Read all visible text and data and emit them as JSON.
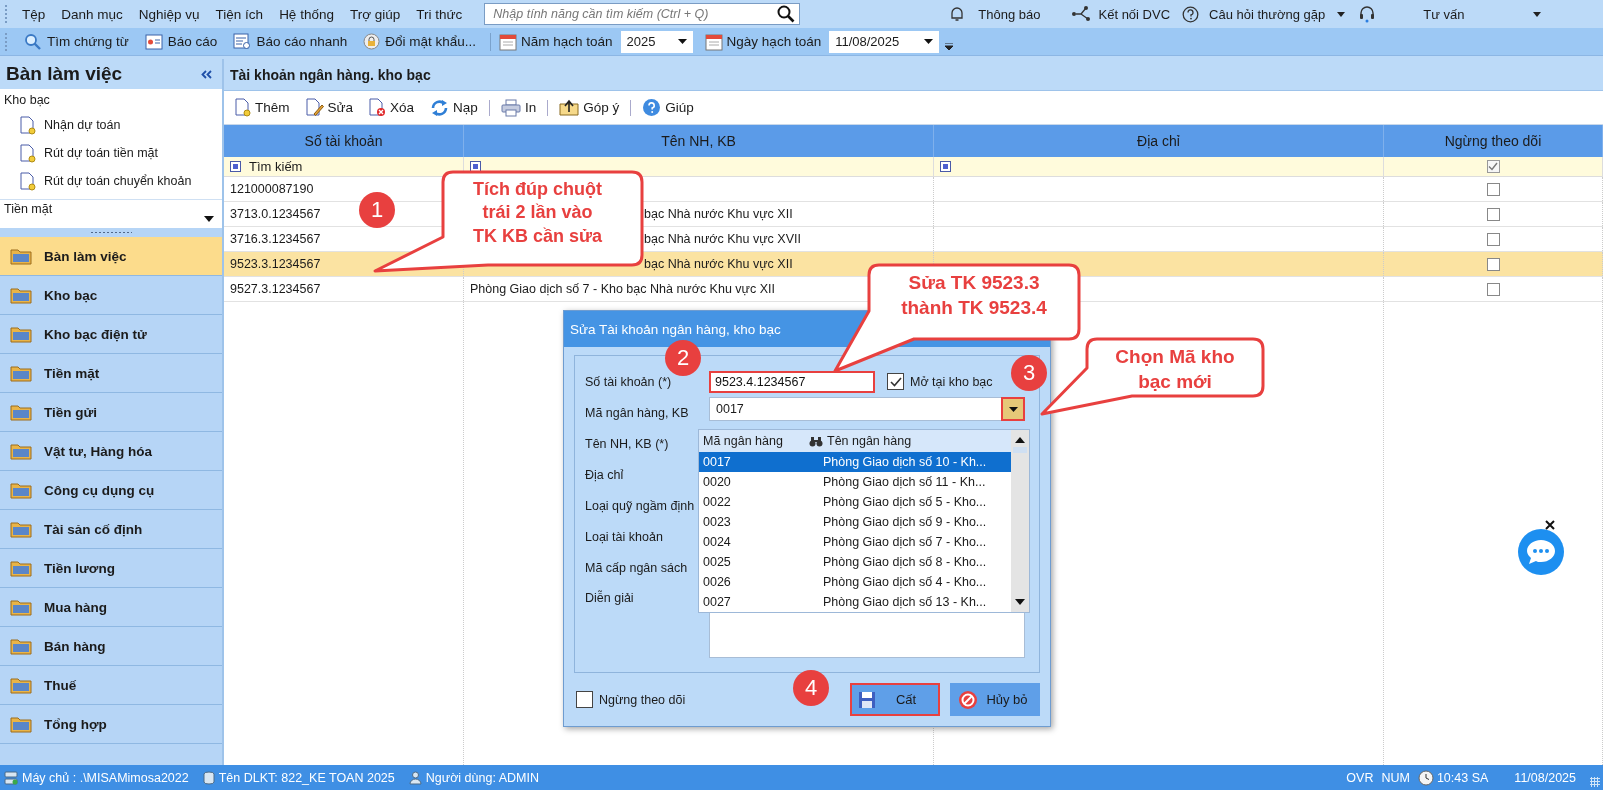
{
  "menu": [
    "Tệp",
    "Danh mục",
    "Nghiệp vụ",
    "Tiện ích",
    "Hệ thống",
    "Trợ giúp",
    "Tri thức"
  ],
  "search": {
    "placeholder": "Nhập tính năng cần tìm kiếm (Ctrl + Q)"
  },
  "top_links": [
    {
      "kind": "bell",
      "label": "Thông báo",
      "dropdown": false
    },
    {
      "kind": "network",
      "label": "Kết nối DVC",
      "dropdown": false
    },
    {
      "kind": "help",
      "label": "Câu hỏi thường gặp",
      "dropdown": true
    },
    {
      "kind": "headset",
      "label": "Tư vấn",
      "dropdown": true
    }
  ],
  "toolbar": [
    {
      "kind": "search",
      "label": "Tìm chứng từ"
    },
    {
      "kind": "report",
      "label": "Báo cáo"
    },
    {
      "kind": "quick_report",
      "label": "Báo cáo nhanh"
    },
    {
      "kind": "password",
      "label": "Đổi mật khẩu..."
    }
  ],
  "fiscal_year": {
    "label": "Năm hạch toán",
    "value": "2025"
  },
  "posting_date": {
    "label": "Ngày hạch toán",
    "value": "11/08/2025"
  },
  "sidebar": {
    "title": "Bàn làm việc",
    "tree": [
      {
        "label": "Kho bạc",
        "children": [
          {
            "label": "Nhận dự toán"
          },
          {
            "label": "Rút dự toán tiền mặt"
          },
          {
            "label": "Rút dự toán chuyển khoản"
          }
        ]
      }
    ],
    "group_select": "Tiền mặt",
    "items": [
      {
        "label": "Bàn làm việc",
        "selected": true
      },
      {
        "label": "Kho bạc",
        "selected": false
      },
      {
        "label": "Kho bạc điện tử",
        "selected": false
      },
      {
        "label": "Tiền mặt",
        "selected": false
      },
      {
        "label": "Tiền gửi",
        "selected": false
      },
      {
        "label": "Vật tư, Hàng hóa",
        "selected": false
      },
      {
        "label": "Công cụ dụng cụ",
        "selected": false
      },
      {
        "label": "Tài sản cố định",
        "selected": false
      },
      {
        "label": "Tiền lương",
        "selected": false
      },
      {
        "label": "Mua hàng",
        "selected": false
      },
      {
        "label": "Bán hàng",
        "selected": false
      },
      {
        "label": "Thuế",
        "selected": false
      },
      {
        "label": "Tổng hợp",
        "selected": false
      }
    ]
  },
  "page": {
    "title": "Tài khoản ngân hàng. kho bạc",
    "actions": [
      {
        "kind": "add",
        "label": "Thêm",
        "separator_after": false
      },
      {
        "kind": "edit",
        "label": "Sửa",
        "separator_after": false
      },
      {
        "kind": "delete",
        "label": "Xóa",
        "separator_after": false
      },
      {
        "kind": "reload",
        "label": "Nạp",
        "separator_after": true
      },
      {
        "kind": "print",
        "label": "In",
        "separator_after": true
      },
      {
        "kind": "feedback",
        "label": "Góp ý",
        "separator_after": true
      },
      {
        "kind": "help",
        "label": "Giúp",
        "separator_after": false
      }
    ]
  },
  "table": {
    "columns": [
      "Số tài khoản",
      "Tên NH, KB",
      "Địa chỉ",
      "Ngừng theo dõi"
    ],
    "filter_row": {
      "label": "Tìm kiếm",
      "checked": true
    },
    "rows": [
      {
        "account": "121000087190",
        "stopped": false,
        "selected": false
      },
      {
        "account": "3713.0.1234567",
        "name": "bạc Nhà nước Khu vực XII",
        "covered": true,
        "stopped": false,
        "selected": false
      },
      {
        "account": "3716.3.1234567",
        "name": "bạc Nhà nước Khu vực XVII",
        "covered": true,
        "stopped": false,
        "selected": false
      },
      {
        "account": "9523.3.1234567",
        "name": "bạc Nhà nước Khu vực XII",
        "covered": true,
        "stopped": false,
        "selected": true
      },
      {
        "account": "9527.3.1234567",
        "name": "Phòng Giao dịch số 7 - Kho bạc Nhà nước Khu vực XII",
        "covered": false,
        "stopped": false,
        "selected": false
      }
    ]
  },
  "dialog": {
    "title": "Sửa Tài khoản ngân hàng, kho bạc",
    "account": {
      "label": "Số tài khoản (*)",
      "value": "9523.4.1234567",
      "highlighted": true
    },
    "treasury_checkbox": {
      "label": "Mở tại kho bạc",
      "checked": true
    },
    "bank_code": {
      "label": "Mã ngân hàng, KB",
      "value": "0017",
      "button_highlighted": true
    },
    "labels": [
      "Tên NH, KB (*)",
      "Địa chỉ",
      "Loại quỹ ngầm định",
      "Loại tài khoản",
      "Mã cấp ngân sách",
      "Diễn giải"
    ],
    "dropdown": {
      "columns": [
        "Mã ngân hàng",
        "Tên ngân hàng"
      ],
      "rows": [
        {
          "code": "0017",
          "name": "Phòng Giao dịch số 10 - Kh...",
          "selected": true
        },
        {
          "code": "0020",
          "name": "Phòng Giao dịch số 11 - Kh...",
          "selected": false
        },
        {
          "code": "0022",
          "name": "Phòng Giao dịch số 5 - Kho...",
          "selected": false
        },
        {
          "code": "0023",
          "name": "Phòng Giao dịch số 9 - Kho...",
          "selected": false
        },
        {
          "code": "0024",
          "name": "Phòng Giao dịch số 7 - Kho...",
          "selected": false
        },
        {
          "code": "0025",
          "name": "Phòng Giao dịch số 8 - Kho...",
          "selected": false
        },
        {
          "code": "0026",
          "name": "Phòng Giao dịch số 4 - Kho...",
          "selected": false
        },
        {
          "code": "0027",
          "name": "Phòng Giao dịch số 13 - Kh...",
          "selected": false
        }
      ]
    },
    "stop_tracking": {
      "label": "Ngừng theo dõi",
      "checked": false
    },
    "buttons": [
      {
        "kind": "save",
        "label": "Cất",
        "highlighted": true
      },
      {
        "kind": "cancel",
        "label": "Hủy bỏ",
        "highlighted": false
      }
    ]
  },
  "annotations": {
    "steps": [
      "1",
      "2",
      "3",
      "4"
    ],
    "callouts": [
      "Tích đúp chuột trái 2 lần vào TK KB cần sửa",
      "Sửa TK 9523.3 thành TK 9523.4",
      "Chọn Mã kho bạc mới"
    ]
  },
  "status_bar": {
    "items": [
      {
        "kind": "server",
        "text": "Máy chủ : .\\MISAMimosa2022"
      },
      {
        "kind": "database",
        "text": "Tên DLKT: 822_KE TOAN 2025"
      },
      {
        "kind": "user",
        "text": "Người dùng: ADMIN"
      }
    ],
    "modes": [
      "OVR",
      "NUM"
    ],
    "time": "10:43 SA",
    "date": "11/08/2025"
  }
}
